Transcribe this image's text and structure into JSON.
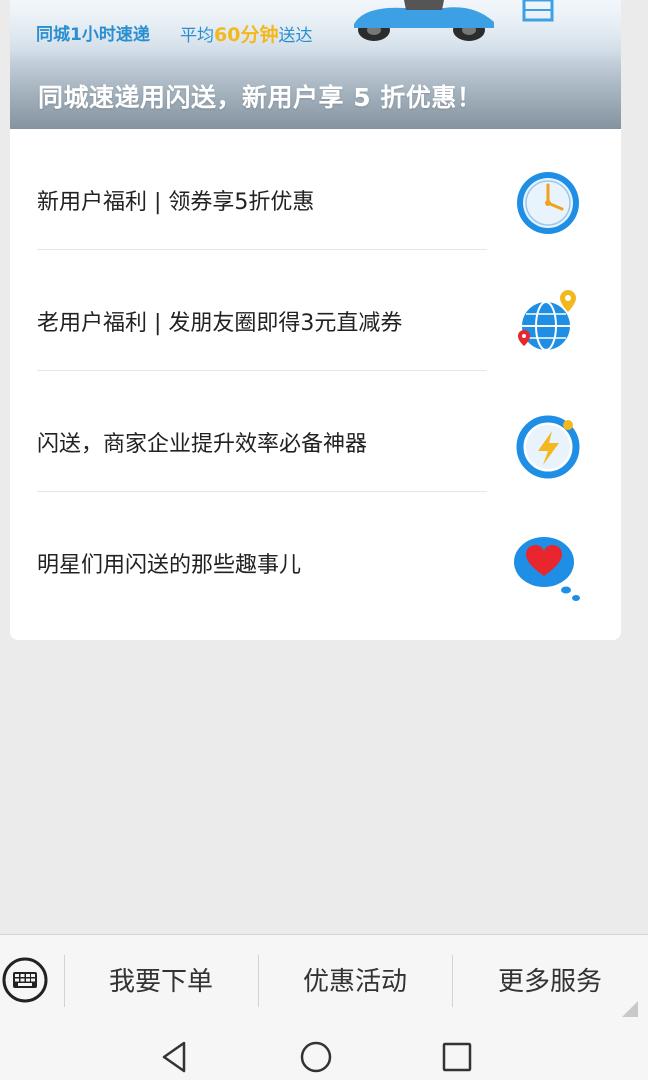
{
  "banner": {
    "slogan_left": "同城1小时速递",
    "slogan_right_prefix": "平均",
    "slogan_right_highlight": "60分钟",
    "slogan_right_suffix": "送达",
    "headline": "同城速递用闪送，新用户享 5 折优惠！"
  },
  "list": {
    "items": [
      {
        "label": "新用户福利 | 领券享5折优惠",
        "icon": "clock-icon"
      },
      {
        "label": "老用户福利 | 发朋友圈即得3元直减券",
        "icon": "globe-pin-icon"
      },
      {
        "label": "闪送，商家企业提升效率必备神器",
        "icon": "lightning-icon"
      },
      {
        "label": "明星们用闪送的那些趣事儿",
        "icon": "heart-bubble-icon"
      }
    ]
  },
  "menu": {
    "keyboard_icon": "keyboard-icon",
    "items": [
      "我要下单",
      "优惠活动",
      "更多服务"
    ]
  },
  "navbar": {
    "icons": [
      "back-icon",
      "home-icon",
      "recents-icon"
    ]
  },
  "colors": {
    "accent_blue": "#2a8fd0",
    "highlight_yellow": "#f3b81d",
    "icon_blue": "#1f8ee5",
    "heart_red": "#e8262d"
  }
}
